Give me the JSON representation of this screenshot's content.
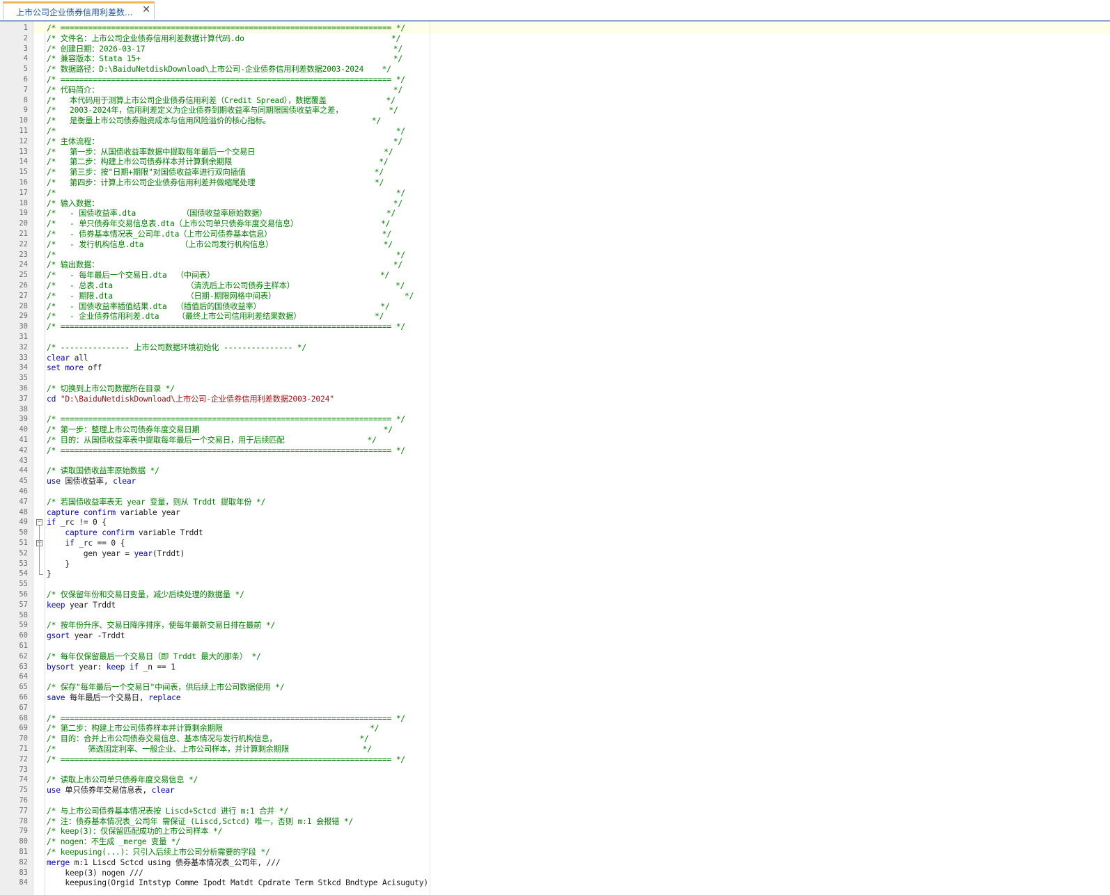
{
  "tab": {
    "title": "上市公司企业债券信用利差数...",
    "close_glyph": "✕"
  },
  "colors": {
    "comment": "#008000",
    "keyword": "#0000c8",
    "string": "#a31515",
    "caret_line": "#ffffe8"
  },
  "lines": [
    {
      "n": "1",
      "segs": [
        [
          "cm",
          "/* ======================================================================== */"
        ]
      ]
    },
    {
      "n": "2",
      "segs": [
        [
          "cm",
          "/* 文件名：上市公司企业债券信用利差数据计算代码.do                                */"
        ]
      ]
    },
    {
      "n": "3",
      "segs": [
        [
          "cm",
          "/* 创建日期：2026-03-17                                                      */"
        ]
      ]
    },
    {
      "n": "4",
      "segs": [
        [
          "cm",
          "/* 兼容版本：Stata 15+                                                       */"
        ]
      ]
    },
    {
      "n": "5",
      "segs": [
        [
          "cm",
          "/* 数据路径：D:\\BaiduNetdiskDownload\\上市公司-企业债券信用利差数据2003-2024    */"
        ]
      ]
    },
    {
      "n": "6",
      "segs": [
        [
          "cm",
          "/* ======================================================================== */"
        ]
      ]
    },
    {
      "n": "7",
      "segs": [
        [
          "cm",
          "/* 代码简介：                                                                */"
        ]
      ]
    },
    {
      "n": "8",
      "segs": [
        [
          "cm",
          "/*   本代码用于测算上市公司企业债券信用利差（Credit Spread），数据覆盖             */"
        ]
      ]
    },
    {
      "n": "9",
      "segs": [
        [
          "cm",
          "/*   2003-2024年，信用利差定义为企业债券到期收益率与同期限国债收益率之差，          */"
        ]
      ]
    },
    {
      "n": "10",
      "segs": [
        [
          "cm",
          "/*   是衡量上市公司债券融资成本与信用风险溢价的核心指标。                      */"
        ]
      ]
    },
    {
      "n": "11",
      "segs": [
        [
          "cm",
          "/*                                                                          */"
        ]
      ]
    },
    {
      "n": "12",
      "segs": [
        [
          "cm",
          "/* 主体流程：                                                                */"
        ]
      ]
    },
    {
      "n": "13",
      "segs": [
        [
          "cm",
          "/*   第一步：从国债收益率数据中提取每年最后一个交易日                            */"
        ]
      ]
    },
    {
      "n": "14",
      "segs": [
        [
          "cm",
          "/*   第二步：构建上市公司债券样本并计算剩余期限                                */"
        ]
      ]
    },
    {
      "n": "15",
      "segs": [
        [
          "cm",
          "/*   第三步：按\"日期+期限\"对国债收益率进行双向插值                            */"
        ]
      ]
    },
    {
      "n": "16",
      "segs": [
        [
          "cm",
          "/*   第四步：计算上市公司企业债券信用利差并做缩尾处理                          */"
        ]
      ]
    },
    {
      "n": "17",
      "segs": [
        [
          "cm",
          "/*                                                                          */"
        ]
      ]
    },
    {
      "n": "18",
      "segs": [
        [
          "cm",
          "/* 输入数据：                                                                */"
        ]
      ]
    },
    {
      "n": "19",
      "segs": [
        [
          "cm",
          "/*   - 国债收益率.dta          （国债收益率原始数据）                          */"
        ]
      ]
    },
    {
      "n": "20",
      "segs": [
        [
          "cm",
          "/*   - 单只债券年交易信息表.dta（上市公司单只债券年度交易信息）                  */"
        ]
      ]
    },
    {
      "n": "21",
      "segs": [
        [
          "cm",
          "/*   - 债券基本情况表_公司年.dta（上市公司债券基本信息）                        */"
        ]
      ]
    },
    {
      "n": "22",
      "segs": [
        [
          "cm",
          "/*   - 发行机构信息.dta        （上市公司发行机构信息）                        */"
        ]
      ]
    },
    {
      "n": "23",
      "segs": [
        [
          "cm",
          "/*                                                                          */"
        ]
      ]
    },
    {
      "n": "24",
      "segs": [
        [
          "cm",
          "/* 输出数据：                                                                */"
        ]
      ]
    },
    {
      "n": "25",
      "segs": [
        [
          "cm",
          "/*   - 每年最后一个交易日.dta  （中间表）                                    */"
        ]
      ]
    },
    {
      "n": "26",
      "segs": [
        [
          "cm",
          "/*   - 总表.dta                （清洗后上市公司债券主样本）                      */"
        ]
      ]
    },
    {
      "n": "27",
      "segs": [
        [
          "cm",
          "/*   - 期限.dta                （日期-期限网格中间表）                            */"
        ]
      ]
    },
    {
      "n": "28",
      "segs": [
        [
          "cm",
          "/*   - 国债收益率插值结果.dta  （插值后的国债收益率）                          */"
        ]
      ]
    },
    {
      "n": "29",
      "segs": [
        [
          "cm",
          "/*   - 企业债券信用利差.dta    （最终上市公司信用利差结果数据）                */"
        ]
      ]
    },
    {
      "n": "30",
      "segs": [
        [
          "cm",
          "/* ======================================================================== */"
        ]
      ]
    },
    {
      "n": "31",
      "segs": []
    },
    {
      "n": "32",
      "segs": [
        [
          "cm",
          "/* --------------- 上市公司数据环境初始化 --------------- */"
        ]
      ]
    },
    {
      "n": "33",
      "segs": [
        [
          "kw",
          "clear"
        ],
        [
          "plain",
          " all"
        ]
      ]
    },
    {
      "n": "34",
      "segs": [
        [
          "kw",
          "set"
        ],
        [
          "plain",
          " "
        ],
        [
          "kw",
          "more"
        ],
        [
          "plain",
          " off"
        ]
      ]
    },
    {
      "n": "35",
      "segs": []
    },
    {
      "n": "36",
      "segs": [
        [
          "cm",
          "/* 切换到上市公司数据所在目录 */"
        ]
      ]
    },
    {
      "n": "37",
      "segs": [
        [
          "kw",
          "cd"
        ],
        [
          "plain",
          " "
        ],
        [
          "str",
          "\"D:\\BaiduNetdiskDownload\\上市公司-企业债券信用利差数据2003-2024\""
        ]
      ]
    },
    {
      "n": "38",
      "segs": []
    },
    {
      "n": "39",
      "segs": [
        [
          "cm",
          "/* ======================================================================== */"
        ]
      ]
    },
    {
      "n": "40",
      "segs": [
        [
          "cm",
          "/* 第一步：整理上市公司债券年度交易日期                                        */"
        ]
      ]
    },
    {
      "n": "41",
      "segs": [
        [
          "cm",
          "/* 目的：从国债收益率表中提取每年最后一个交易日，用于后续匹配                  */"
        ]
      ]
    },
    {
      "n": "42",
      "segs": [
        [
          "cm",
          "/* ======================================================================== */"
        ]
      ]
    },
    {
      "n": "43",
      "segs": []
    },
    {
      "n": "44",
      "segs": [
        [
          "cm",
          "/* 读取国债收益率原始数据 */"
        ]
      ]
    },
    {
      "n": "45",
      "segs": [
        [
          "kw",
          "use"
        ],
        [
          "plain",
          " 国债收益率, "
        ],
        [
          "kw",
          "clear"
        ]
      ]
    },
    {
      "n": "46",
      "segs": []
    },
    {
      "n": "47",
      "segs": [
        [
          "cm",
          "/* 若国债收益率表无 year 变量，则从 Trddt 提取年份 */"
        ]
      ]
    },
    {
      "n": "48",
      "segs": [
        [
          "kw",
          "capture"
        ],
        [
          "plain",
          " "
        ],
        [
          "kw",
          "confirm"
        ],
        [
          "plain",
          " variable year"
        ]
      ]
    },
    {
      "n": "49",
      "segs": [
        [
          "kw",
          "if"
        ],
        [
          "plain",
          " _rc != 0 {"
        ]
      ]
    },
    {
      "n": "50",
      "segs": [
        [
          "plain",
          "    "
        ],
        [
          "kw",
          "capture"
        ],
        [
          "plain",
          " "
        ],
        [
          "kw",
          "confirm"
        ],
        [
          "plain",
          " variable Trddt"
        ]
      ]
    },
    {
      "n": "51",
      "segs": [
        [
          "plain",
          "    "
        ],
        [
          "kw",
          "if"
        ],
        [
          "plain",
          " _rc == 0 {"
        ]
      ]
    },
    {
      "n": "52",
      "segs": [
        [
          "plain",
          "        gen year = "
        ],
        [
          "fn",
          "year"
        ],
        [
          "plain",
          "(Trddt)"
        ]
      ]
    },
    {
      "n": "53",
      "segs": [
        [
          "plain",
          "    }"
        ]
      ]
    },
    {
      "n": "54",
      "segs": [
        [
          "plain",
          "}"
        ]
      ]
    },
    {
      "n": "55",
      "segs": []
    },
    {
      "n": "56",
      "segs": [
        [
          "cm",
          "/* 仅保留年份和交易日变量，减少后续处理的数据量 */"
        ]
      ]
    },
    {
      "n": "57",
      "segs": [
        [
          "kw",
          "keep"
        ],
        [
          "plain",
          " year Trddt"
        ]
      ]
    },
    {
      "n": "58",
      "segs": []
    },
    {
      "n": "59",
      "segs": [
        [
          "cm",
          "/* 按年份升序、交易日降序排序，使每年最新交易日排在最前 */"
        ]
      ]
    },
    {
      "n": "60",
      "segs": [
        [
          "kw",
          "gsort"
        ],
        [
          "plain",
          " year -Trddt"
        ]
      ]
    },
    {
      "n": "61",
      "segs": []
    },
    {
      "n": "62",
      "segs": [
        [
          "cm",
          "/* 每年仅保留最后一个交易日（即 Trddt 最大的那条） */"
        ]
      ]
    },
    {
      "n": "63",
      "segs": [
        [
          "kw",
          "bysort"
        ],
        [
          "plain",
          " year: "
        ],
        [
          "kw",
          "keep"
        ],
        [
          "plain",
          " "
        ],
        [
          "kw",
          "if"
        ],
        [
          "plain",
          " _n == 1"
        ]
      ]
    },
    {
      "n": "64",
      "segs": []
    },
    {
      "n": "65",
      "segs": [
        [
          "cm",
          "/* 保存\"每年最后一个交易日\"中间表，供后续上市公司数据使用 */"
        ]
      ]
    },
    {
      "n": "66",
      "segs": [
        [
          "kw",
          "save"
        ],
        [
          "plain",
          " 每年最后一个交易日, "
        ],
        [
          "kw",
          "replace"
        ]
      ]
    },
    {
      "n": "67",
      "segs": []
    },
    {
      "n": "68",
      "segs": [
        [
          "cm",
          "/* ======================================================================== */"
        ]
      ]
    },
    {
      "n": "69",
      "segs": [
        [
          "cm",
          "/* 第二步：构建上市公司债券样本并计算剩余期限                                */"
        ]
      ]
    },
    {
      "n": "70",
      "segs": [
        [
          "cm",
          "/* 目的：合并上市公司债券交易信息、基本情况与发行机构信息，                  */"
        ]
      ]
    },
    {
      "n": "71",
      "segs": [
        [
          "cm",
          "/*       筛选固定利率、一般企业、上市公司样本，并计算剩余期限                */"
        ]
      ]
    },
    {
      "n": "72",
      "segs": [
        [
          "cm",
          "/* ======================================================================== */"
        ]
      ]
    },
    {
      "n": "73",
      "segs": []
    },
    {
      "n": "74",
      "segs": [
        [
          "cm",
          "/* 读取上市公司单只债券年度交易信息 */"
        ]
      ]
    },
    {
      "n": "75",
      "segs": [
        [
          "kw",
          "use"
        ],
        [
          "plain",
          " 单只债券年交易信息表, "
        ],
        [
          "kw",
          "clear"
        ]
      ]
    },
    {
      "n": "76",
      "segs": []
    },
    {
      "n": "77",
      "segs": [
        [
          "cm",
          "/* 与上市公司债券基本情况表按 Liscd+Sctcd 进行 m:1 合并 */"
        ]
      ]
    },
    {
      "n": "78",
      "segs": [
        [
          "cm",
          "/* 注：债券基本情况表_公司年 需保证 (Liscd,Sctcd) 唯一，否则 m:1 会报错 */"
        ]
      ]
    },
    {
      "n": "79",
      "segs": [
        [
          "cm",
          "/* keep(3)：仅保留匹配成功的上市公司样本 */"
        ]
      ]
    },
    {
      "n": "80",
      "segs": [
        [
          "cm",
          "/* nogen：不生成 _merge 变量 */"
        ]
      ]
    },
    {
      "n": "81",
      "segs": [
        [
          "cm",
          "/* keepusing(...)：只引入后续上市公司分析需要的字段 */"
        ]
      ]
    },
    {
      "n": "82",
      "segs": [
        [
          "kw",
          "merge"
        ],
        [
          "plain",
          " m:1 Liscd Sctcd using 债券基本情况表_公司年, ///"
        ]
      ]
    },
    {
      "n": "83",
      "segs": [
        [
          "plain",
          "    keep(3) nogen ///"
        ]
      ]
    },
    {
      "n": "84",
      "segs": [
        [
          "plain",
          "    keepusing(Orgid Intstyp Comme Ipodt Matdt Cpdrate Term Stkcd Bndtype Acisuguty)"
        ]
      ]
    }
  ]
}
